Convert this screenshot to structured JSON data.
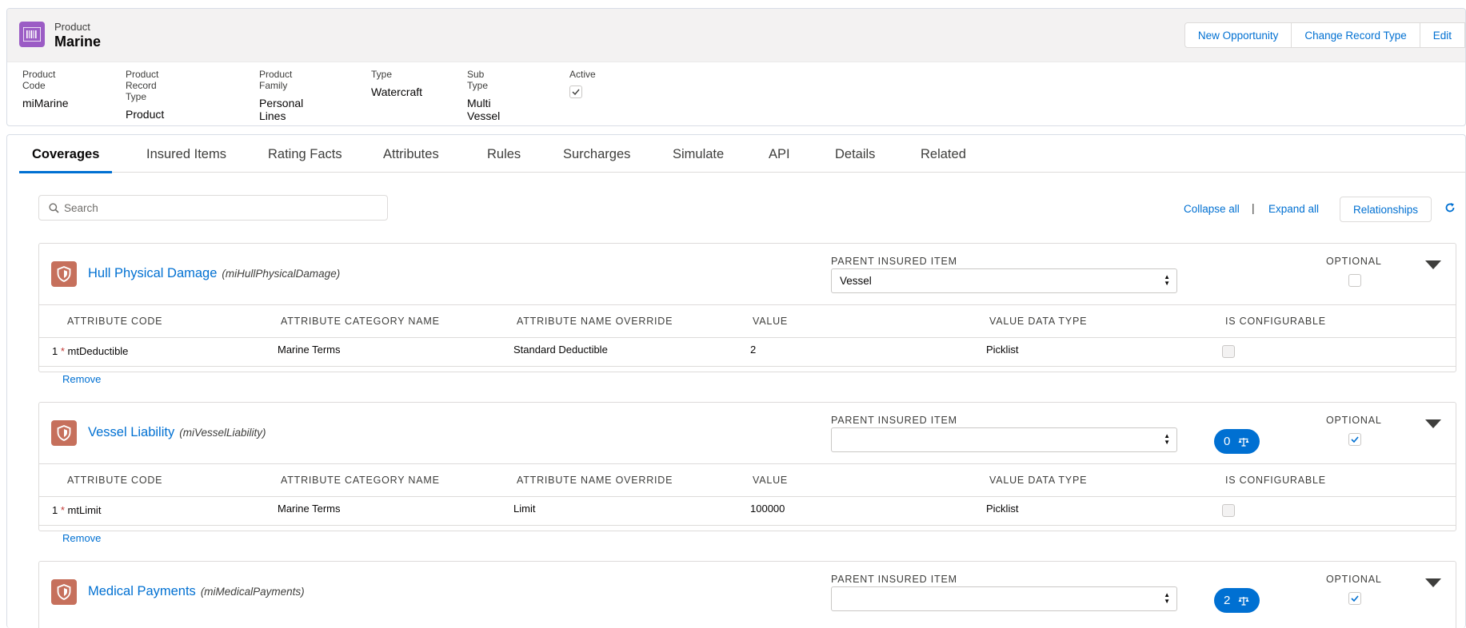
{
  "header": {
    "object_label": "Product",
    "record_title": "Marine",
    "icon": "product-barcode-icon",
    "buttons": [
      "New Opportunity",
      "Change Record Type",
      "Edit"
    ]
  },
  "fields": [
    {
      "label": "Product Code",
      "value": "miMarine"
    },
    {
      "label": "Product Record Type",
      "value": "Product"
    },
    {
      "label": "Product Family",
      "value": "Personal Lines"
    },
    {
      "label": "Type",
      "value": "Watercraft"
    },
    {
      "label": "Sub Type",
      "value": "Multi Vessel"
    },
    {
      "label": "Active",
      "value": "",
      "checked": true
    }
  ],
  "tabs": [
    "Coverages",
    "Insured Items",
    "Rating Facts",
    "Attributes",
    "Rules",
    "Surcharges",
    "Simulate",
    "API",
    "Details",
    "Related"
  ],
  "active_tab": "Coverages",
  "toolbar": {
    "search_placeholder": "Search",
    "collapse_all": "Collapse all",
    "separator": "|",
    "expand_all": "Expand all",
    "relationships": "Relationships"
  },
  "column_headers": {
    "parent_insured_item": "PARENT INSURED ITEM",
    "optional": "OPTIONAL",
    "attribute_code": "ATTRIBUTE CODE",
    "attribute_category_name": "ATTRIBUTE CATEGORY NAME",
    "attribute_name_override": "ATTRIBUTE NAME OVERRIDE",
    "value": "VALUE",
    "value_data_type": "VALUE DATA TYPE",
    "is_configurable": "IS CONFIGURABLE"
  },
  "coverages": [
    {
      "name": "Hull Physical Damage",
      "code": "(miHullPhysicalDamage)",
      "parent_insured_item": "Vessel",
      "optional": false,
      "remove": "Remove",
      "attributes": [
        {
          "index": "1",
          "required": "*",
          "code": "mtDeductible",
          "category": "Marine Terms",
          "name_override": "Standard Deductible",
          "value": "2",
          "data_type": "Picklist"
        }
      ]
    },
    {
      "name": "Vessel Liability",
      "code": "(miVesselLiability)",
      "parent_insured_item": "",
      "rules_count": "0",
      "optional": true,
      "remove": "Remove",
      "attributes": [
        {
          "index": "1",
          "required": "*",
          "code": "mtLimit",
          "category": "Marine Terms",
          "name_override": "Limit",
          "value": "100000",
          "data_type": "Picklist"
        }
      ]
    },
    {
      "name": "Medical Payments",
      "code": "(miMedicalPayments)",
      "parent_insured_item": "",
      "rules_count": "2",
      "optional": true
    }
  ],
  "colors": {
    "brand": "#0070d2",
    "product_icon": "#9b5cc5",
    "coverage_icon": "#c6705c"
  }
}
